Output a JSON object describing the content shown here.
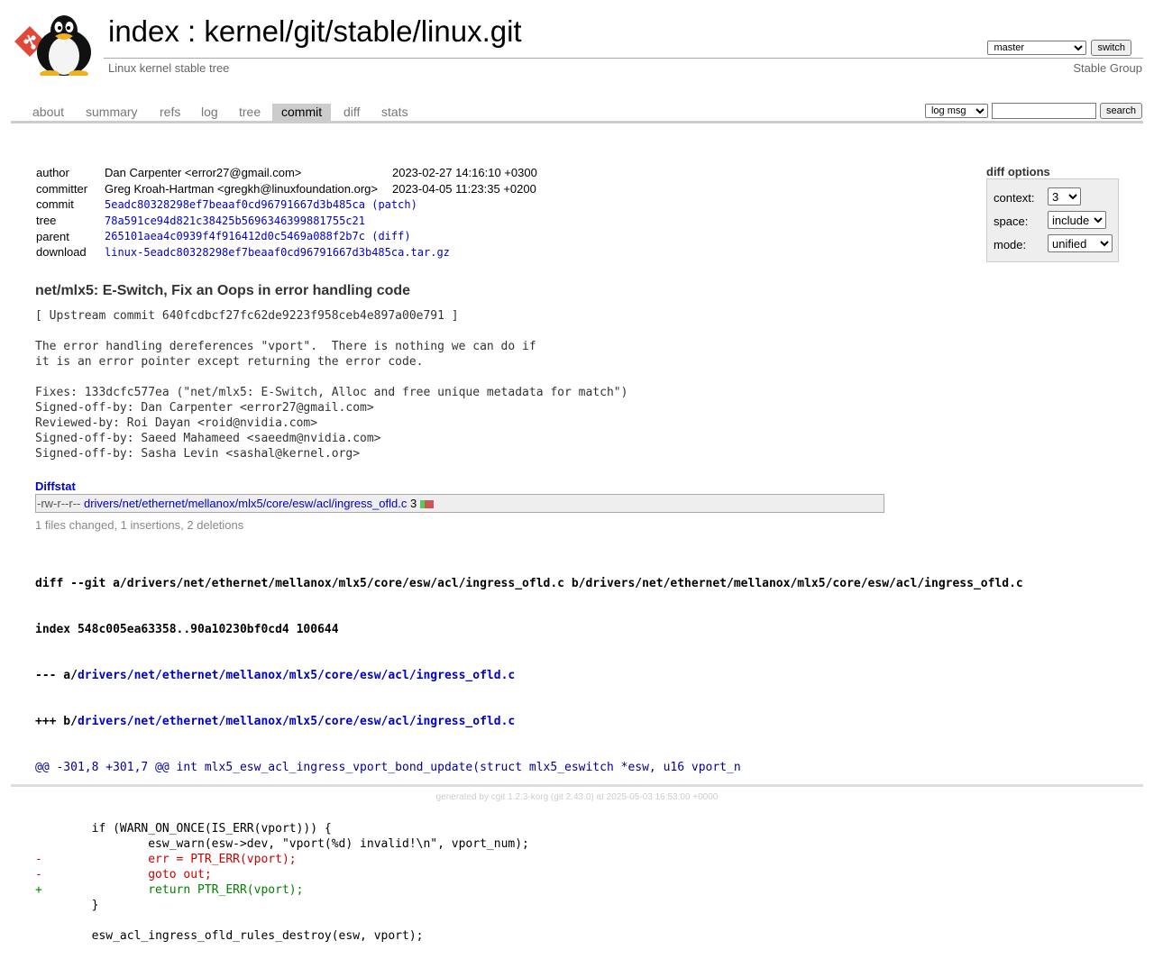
{
  "header": {
    "title_index": "index",
    "title_sep": " : ",
    "title_repo": "kernel/git/stable/linux.git",
    "subtitle": "Linux kernel stable tree",
    "owner": "Stable Group",
    "branch_selected": "master",
    "switch_label": "switch"
  },
  "tabs": [
    {
      "label": "about"
    },
    {
      "label": "summary"
    },
    {
      "label": "refs"
    },
    {
      "label": "log"
    },
    {
      "label": "tree"
    },
    {
      "label": "commit"
    },
    {
      "label": "diff"
    },
    {
      "label": "stats"
    }
  ],
  "active_tab": "commit",
  "search": {
    "mode_selected": "log msg",
    "query": "",
    "button_label": "search"
  },
  "commit_info": {
    "author_label": "author",
    "author": "Dan Carpenter <error27@gmail.com>",
    "author_date": "2023-02-27 14:16:10 +0300",
    "committer_label": "committer",
    "committer": "Greg Kroah-Hartman <gregkh@linuxfoundation.org>",
    "committer_date": "2023-04-05 11:23:35 +0200",
    "commit_label": "commit",
    "commit_hash": "5eadc80328298ef7beaaf0cd96791667d3b485ca",
    "patch_link": "patch",
    "tree_label": "tree",
    "tree_hash": "78a591ce94d821c38425b5696346399881755c21",
    "parent_label": "parent",
    "parent_hash": "265101aea4c0939f4f916412d0c5469a088f2b7c",
    "diff_link": "diff",
    "download_label": "download",
    "download_file": "linux-5eadc80328298ef7beaaf0cd96791667d3b485ca.tar.gz"
  },
  "diff_options": {
    "title": "diff options",
    "context_label": "context:",
    "context_value": "3",
    "space_label": "space:",
    "space_value": "include",
    "mode_label": "mode:",
    "mode_value": "unified"
  },
  "message": {
    "subject": "net/mlx5: E-Switch, Fix an Oops in error handling code",
    "body": "[ Upstream commit 640fcdbcf27fc62de9223f958ceb4e897a00e791 ]\n\nThe error handling dereferences \"vport\".  There is nothing we can do if\nit is an error pointer except returning the error code.\n\nFixes: 133dcfc577ea (\"net/mlx5: E-Switch, Alloc and free unique metadata for match\")\nSigned-off-by: Dan Carpenter <error27@gmail.com>\nReviewed-by: Roi Dayan <roid@nvidia.com>\nSigned-off-by: Saeed Mahameed <saeedm@nvidia.com>\nSigned-off-by: Sasha Levin <sashal@kernel.org>"
  },
  "diffstat": {
    "header": "Diffstat",
    "mode": "-rw-r--r--",
    "file": "drivers/net/ethernet/mellanox/mlx5/core/esw/acl/ingress_ofld.c",
    "changes": "3",
    "insertions": 1,
    "deletions": 2,
    "colors": {
      "add": "#5c5",
      "del": "#c55"
    },
    "summary": "1 files changed, 1 insertions, 2 deletions"
  },
  "diff": {
    "git_line": "diff --git a/drivers/net/ethernet/mellanox/mlx5/core/esw/acl/ingress_ofld.c b/drivers/net/ethernet/mellanox/mlx5/core/esw/acl/ingress_ofld.c",
    "index_line": "index 548c005ea63358..90a10230bf0cd4 100644",
    "minus_prefix": "--- a/",
    "minus_file": "drivers/net/ethernet/mellanox/mlx5/core/esw/acl/ingress_ofld.c",
    "plus_prefix": "+++ b/",
    "plus_file": "drivers/net/ethernet/mellanox/mlx5/core/esw/acl/ingress_ofld.c",
    "hunk": "@@ -301,8 +301,7 @@ int mlx5_esw_acl_ingress_vport_bond_update(struct mlx5_eswitch *esw, u16 vport_n",
    "lines": [
      {
        "type": "ctx",
        "text": ""
      },
      {
        "type": "ctx",
        "text": " \tif (WARN_ON_ONCE(IS_ERR(vport))) {"
      },
      {
        "type": "ctx",
        "text": " \t\tesw_warn(esw->dev, \"vport(%d) invalid!\\n\", vport_num);"
      },
      {
        "type": "del",
        "text": "-\t\terr = PTR_ERR(vport);"
      },
      {
        "type": "del",
        "text": "-\t\tgoto out;"
      },
      {
        "type": "add",
        "text": "+\t\treturn PTR_ERR(vport);"
      },
      {
        "type": "ctx",
        "text": " \t}"
      },
      {
        "type": "ctx",
        "text": ""
      },
      {
        "type": "ctx",
        "text": " \tesw_acl_ingress_ofld_rules_destroy(esw, vport);"
      }
    ]
  },
  "footer": {
    "prefix": "generated by ",
    "cgit": "cgit 1.2.3-korg",
    "git_open": " (",
    "git": "git 2.43.0",
    "suffix": ") at 2025-05-03 16:53:00 +0000"
  }
}
